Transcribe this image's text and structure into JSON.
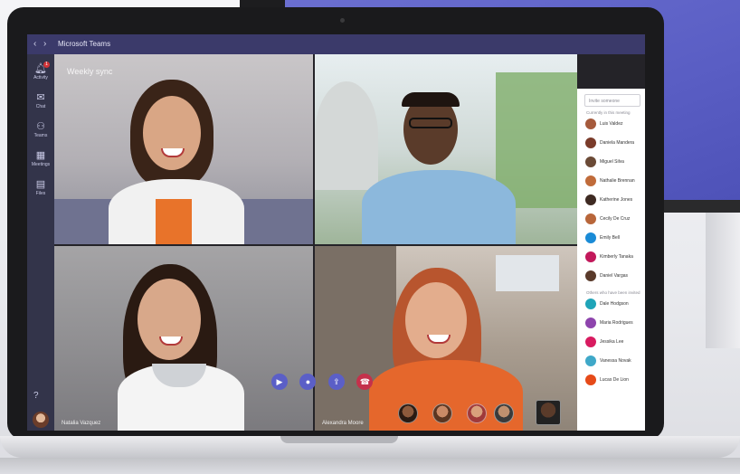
{
  "app": {
    "title": "Microsoft Teams"
  },
  "meeting": {
    "title": "Weekly sync"
  },
  "rail": {
    "items": [
      {
        "icon": "bell-icon",
        "label": "Activity",
        "badge": "1"
      },
      {
        "icon": "chat-icon",
        "label": "Chat"
      },
      {
        "icon": "teams-icon",
        "label": "Teams"
      },
      {
        "icon": "calendar-icon",
        "label": "Meetings"
      },
      {
        "icon": "files-icon",
        "label": "Files"
      }
    ]
  },
  "tiles": [
    {
      "name": ""
    },
    {
      "name": ""
    },
    {
      "name": "Natalia Vazquez"
    },
    {
      "name": "Alexandra Moore"
    }
  ],
  "controls": [
    {
      "icon": "video-icon",
      "color": "#5b5fc7"
    },
    {
      "icon": "mic-icon",
      "color": "#5b5fc7"
    },
    {
      "icon": "share-icon",
      "color": "#5b5fc7"
    },
    {
      "icon": "hang-up-icon",
      "color": "#c4314b"
    }
  ],
  "participants": {
    "invite_placeholder": "Invite someone",
    "section_in_meeting": "Currently in this meeting",
    "section_others": "Others who have been invited",
    "in_meeting": [
      {
        "name": "Luis Valdez",
        "color": "#a55a3c"
      },
      {
        "name": "Daniela Mandera",
        "color": "#7a3b2a"
      },
      {
        "name": "Miguel Silva",
        "color": "#6b4a36"
      },
      {
        "name": "Nathalie Brennan",
        "color": "#c06b3a"
      },
      {
        "name": "Katherine Jones",
        "color": "#3e2a22"
      },
      {
        "name": "Cecily De Cruz",
        "color": "#b8663a"
      },
      {
        "name": "Emily Bell",
        "color": "#1a8bd6"
      },
      {
        "name": "Kimberly Tanaka",
        "color": "#c2185b"
      },
      {
        "name": "Daniel Vargas",
        "color": "#5a3a2a"
      }
    ],
    "others": [
      {
        "name": "Dale Hodgson",
        "color": "#1fa4b8"
      },
      {
        "name": "Maria Rodrigues",
        "color": "#8e44ad"
      },
      {
        "name": "Jessika Lee",
        "color": "#d81b60"
      },
      {
        "name": "Vanessa Novak",
        "color": "#3fa8c8"
      },
      {
        "name": "Lucas De Lion",
        "color": "#e64a19"
      }
    ]
  }
}
